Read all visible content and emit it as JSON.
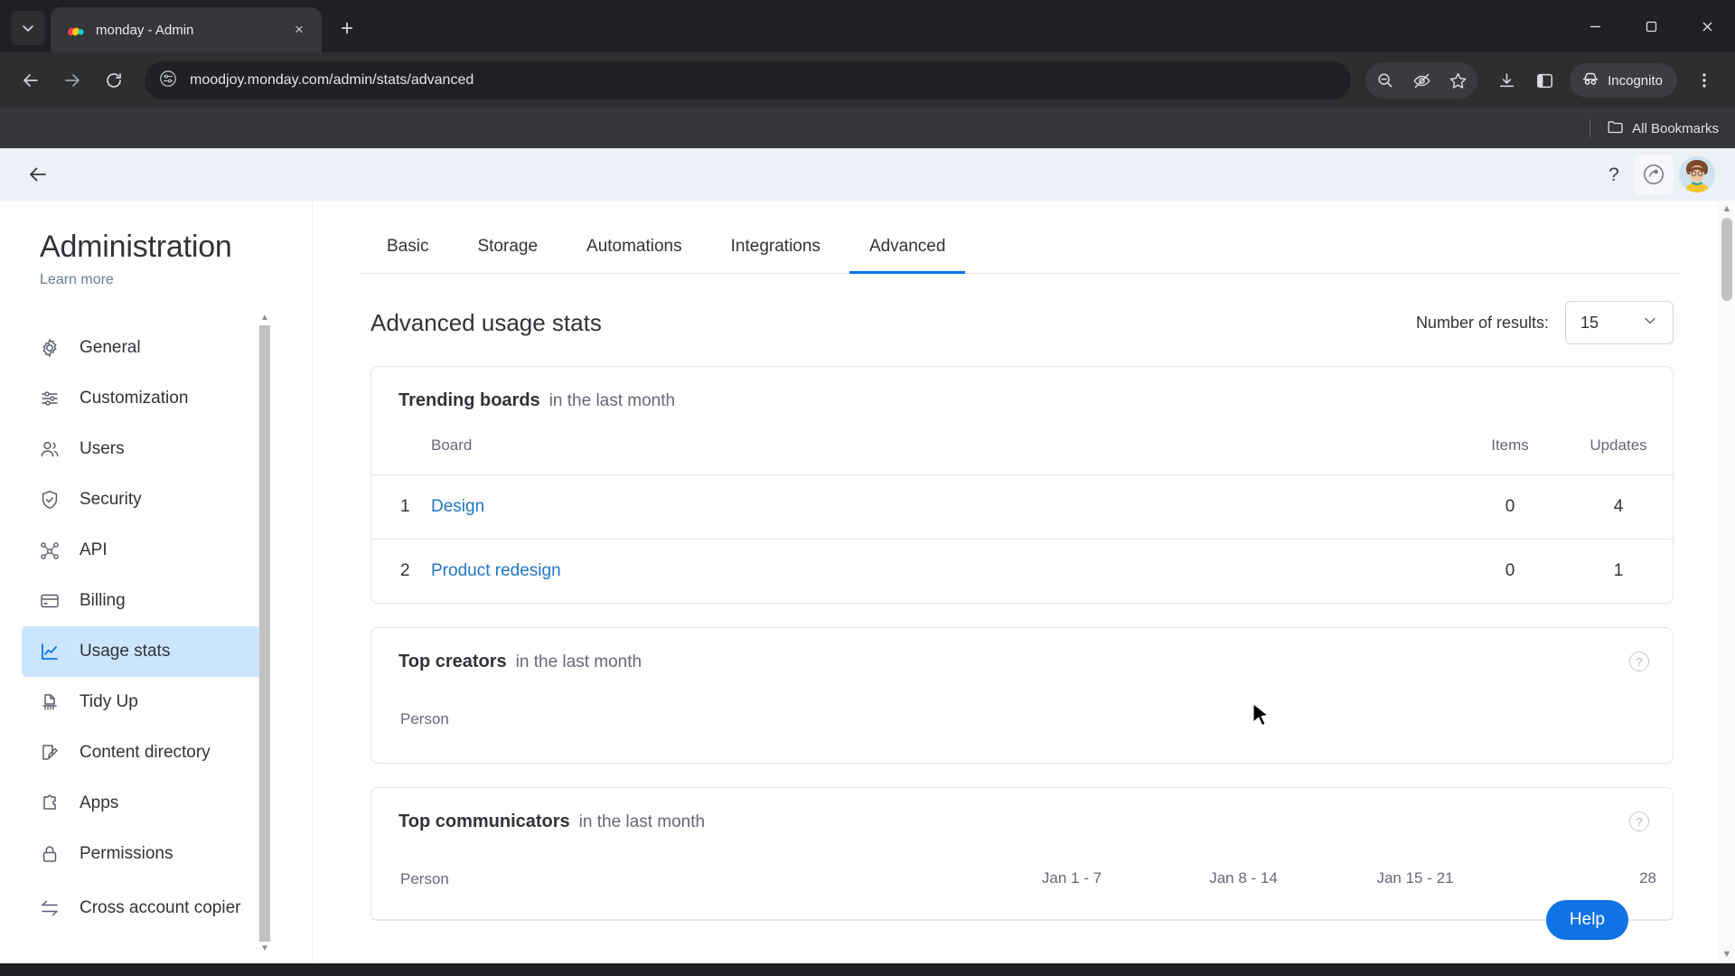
{
  "browser": {
    "tab": {
      "title": "monday - Admin",
      "favicon": "monday-logo-icon",
      "close": "×"
    },
    "newtab_label": "+",
    "window_controls": {
      "minimize": "—",
      "maximize": "▢",
      "close": "✕"
    },
    "nav": {
      "back": "←",
      "forward": "→",
      "reload": "⟳"
    },
    "omnibox": {
      "url": "moodjoy.monday.com/admin/stats/advanced",
      "site_info_icon": "page-settings-icon"
    },
    "toolbar_icons": [
      "zoom-out-icon",
      "eye-slash-icon",
      "star-icon",
      "download-icon",
      "side-panel-icon",
      "three-dot-menu-icon"
    ],
    "incognito": {
      "label": "Incognito",
      "icon": "incognito-hat-icon"
    },
    "bookmarks": {
      "all_label": "All Bookmarks",
      "folder_icon": "folder-icon"
    }
  },
  "app_header": {
    "back": "←",
    "help_icon": "question-mark-icon",
    "notifications_icon": "product-updates-icon",
    "avatar": "user-avatar"
  },
  "sidebar": {
    "title": "Administration",
    "learn_more": "Learn more",
    "items": [
      {
        "label": "General",
        "icon": "gear-icon",
        "active": false
      },
      {
        "label": "Customization",
        "icon": "sliders-icon",
        "active": false
      },
      {
        "label": "Users",
        "icon": "users-icon",
        "active": false
      },
      {
        "label": "Security",
        "icon": "shield-check-icon",
        "active": false
      },
      {
        "label": "API",
        "icon": "nodes-icon",
        "active": false
      },
      {
        "label": "Billing",
        "icon": "credit-card-icon",
        "active": false
      },
      {
        "label": "Usage stats",
        "icon": "line-chart-icon",
        "active": true
      },
      {
        "label": "Tidy Up",
        "icon": "broom-icon",
        "active": false
      },
      {
        "label": "Content directory",
        "icon": "document-edit-icon",
        "active": false
      },
      {
        "label": "Apps",
        "icon": "puzzle-icon",
        "active": false
      },
      {
        "label": "Permissions",
        "icon": "lock-icon",
        "active": false
      },
      {
        "label": "Cross account copier",
        "icon": "transfer-arrows-icon",
        "active": false
      }
    ]
  },
  "main": {
    "tabs": [
      {
        "label": "Basic",
        "active": false
      },
      {
        "label": "Storage",
        "active": false
      },
      {
        "label": "Automations",
        "active": false
      },
      {
        "label": "Integrations",
        "active": false
      },
      {
        "label": "Advanced",
        "active": true
      }
    ],
    "title": "Advanced usage stats",
    "results": {
      "label": "Number of results:",
      "value": "15",
      "chevron": "⌄"
    },
    "cards": [
      {
        "title": "Trending boards",
        "subtitle": "in the last month",
        "has_help": false,
        "columns": [
          "Board",
          "Items",
          "Updates"
        ],
        "rows": [
          {
            "rank": "1",
            "name": "Design",
            "items": "0",
            "updates": "4"
          },
          {
            "rank": "2",
            "name": "Product redesign",
            "items": "0",
            "updates": "1"
          }
        ]
      },
      {
        "title": "Top creators",
        "subtitle": "in the last month",
        "has_help": true,
        "columns": [
          "Person"
        ],
        "rows": []
      },
      {
        "title": "Top communicators",
        "subtitle": "in the last month",
        "has_help": true,
        "columns": [
          "Person",
          "Jan 1 - 7",
          "Jan 8 - 14",
          "Jan 15 - 21",
          "28"
        ],
        "rows": []
      }
    ],
    "help_button": "Help"
  },
  "colors": {
    "accent": "#0073ea",
    "link": "#1f76c2",
    "active_nav_bg": "#cce5ff",
    "help_button": "#0f72e5",
    "chrome_dark": "#202124"
  }
}
